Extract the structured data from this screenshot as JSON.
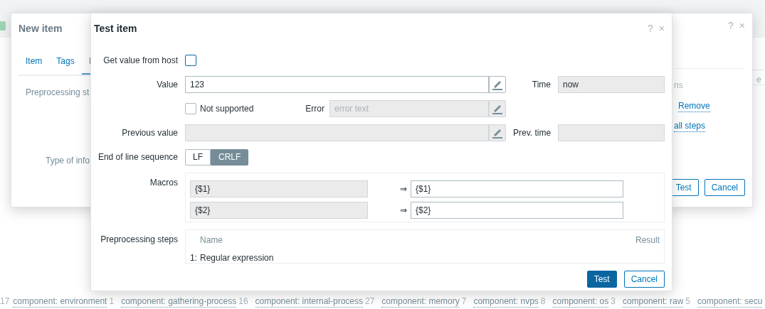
{
  "page": {
    "leading_count": "17",
    "cut_header": "e",
    "tags": [
      {
        "label": "component: environment",
        "count": "1"
      },
      {
        "label": "component: gathering-process",
        "count": "16"
      },
      {
        "label": "component: internal-process",
        "count": "27"
      },
      {
        "label": "component: memory",
        "count": "7"
      },
      {
        "label": "component: nvps",
        "count": "8"
      },
      {
        "label": "component: os",
        "count": "3"
      },
      {
        "label": "component: raw",
        "count": "5"
      },
      {
        "label": "component: secu"
      }
    ]
  },
  "background_dialog": {
    "title": "New item",
    "help": "?",
    "close": "×",
    "tabs": [
      {
        "label": "Item",
        "selected": false
      },
      {
        "label": "Tags",
        "selected": false
      },
      {
        "label": "I",
        "selected": true
      }
    ],
    "left_labels": [
      "Preprocessing st",
      "Type of info"
    ],
    "right_text": "ns",
    "links": [
      "Remove",
      "all steps"
    ],
    "buttons": [
      {
        "label": "Test",
        "kind": "outline"
      },
      {
        "label": "Cancel",
        "kind": "outline"
      }
    ]
  },
  "dialog": {
    "title": "Test item",
    "help": "?",
    "close": "×",
    "get_value_from_host": {
      "label": "Get value from host",
      "checked": false
    },
    "value": {
      "label": "Value",
      "value": "123",
      "disabled": false
    },
    "time": {
      "label": "Time",
      "value": "now",
      "disabled": true
    },
    "not_supported": {
      "label": "Not supported",
      "checked": false
    },
    "error": {
      "label": "Error",
      "placeholder": "error text",
      "disabled": true
    },
    "previous_value": {
      "label": "Previous value",
      "disabled": true
    },
    "prev_time": {
      "label": "Prev. time",
      "disabled": true
    },
    "eol": {
      "label": "End of line sequence",
      "options": [
        {
          "label": "LF",
          "selected": false
        },
        {
          "label": "CRLF",
          "selected": true
        }
      ]
    },
    "macros": {
      "label": "Macros",
      "rows": [
        {
          "macro": "{$1}",
          "arrow": "⇒",
          "value": "{$1}"
        },
        {
          "macro": "{$2}",
          "arrow": "⇒",
          "value": "{$2}"
        }
      ]
    },
    "preprocessing": {
      "label": "Preprocessing steps",
      "columns": [
        "Name",
        "Result"
      ],
      "rows": [
        {
          "index": "1:",
          "name": "Regular expression"
        }
      ]
    },
    "buttons": [
      {
        "label": "Test",
        "kind": "primary"
      },
      {
        "label": "Cancel",
        "kind": "outline"
      }
    ]
  }
}
